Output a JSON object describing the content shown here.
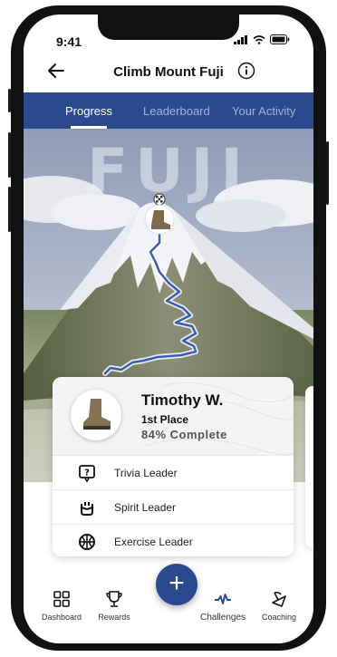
{
  "status": {
    "time": "9:41"
  },
  "header": {
    "title": "Climb Mount Fuji"
  },
  "tabs": [
    {
      "label": "Progress"
    },
    {
      "label": "Leaderboard"
    },
    {
      "label": "Your Activity"
    }
  ],
  "hero": {
    "word": "FUJI"
  },
  "user": {
    "name": "Timothy W.",
    "place": "1st Place",
    "progress": "84% Complete",
    "progress_value": 0.84
  },
  "achievements": [
    {
      "label": "Trivia Leader",
      "icon": "question-icon"
    },
    {
      "label": "Spirit Leader",
      "icon": "hand-icon"
    },
    {
      "label": "Exercise Leader",
      "icon": "basketball-icon"
    }
  ],
  "bottom_nav": [
    {
      "label": "Dashboard",
      "icon": "grid-icon"
    },
    {
      "label": "Rewards",
      "icon": "trophy-icon"
    },
    {
      "label": "Challenges",
      "icon": "pulse-icon"
    },
    {
      "label": "Coaching",
      "icon": "coaching-icon"
    }
  ],
  "colors": {
    "primary": "#2b4a8e",
    "accent": "#3b5cb8"
  }
}
